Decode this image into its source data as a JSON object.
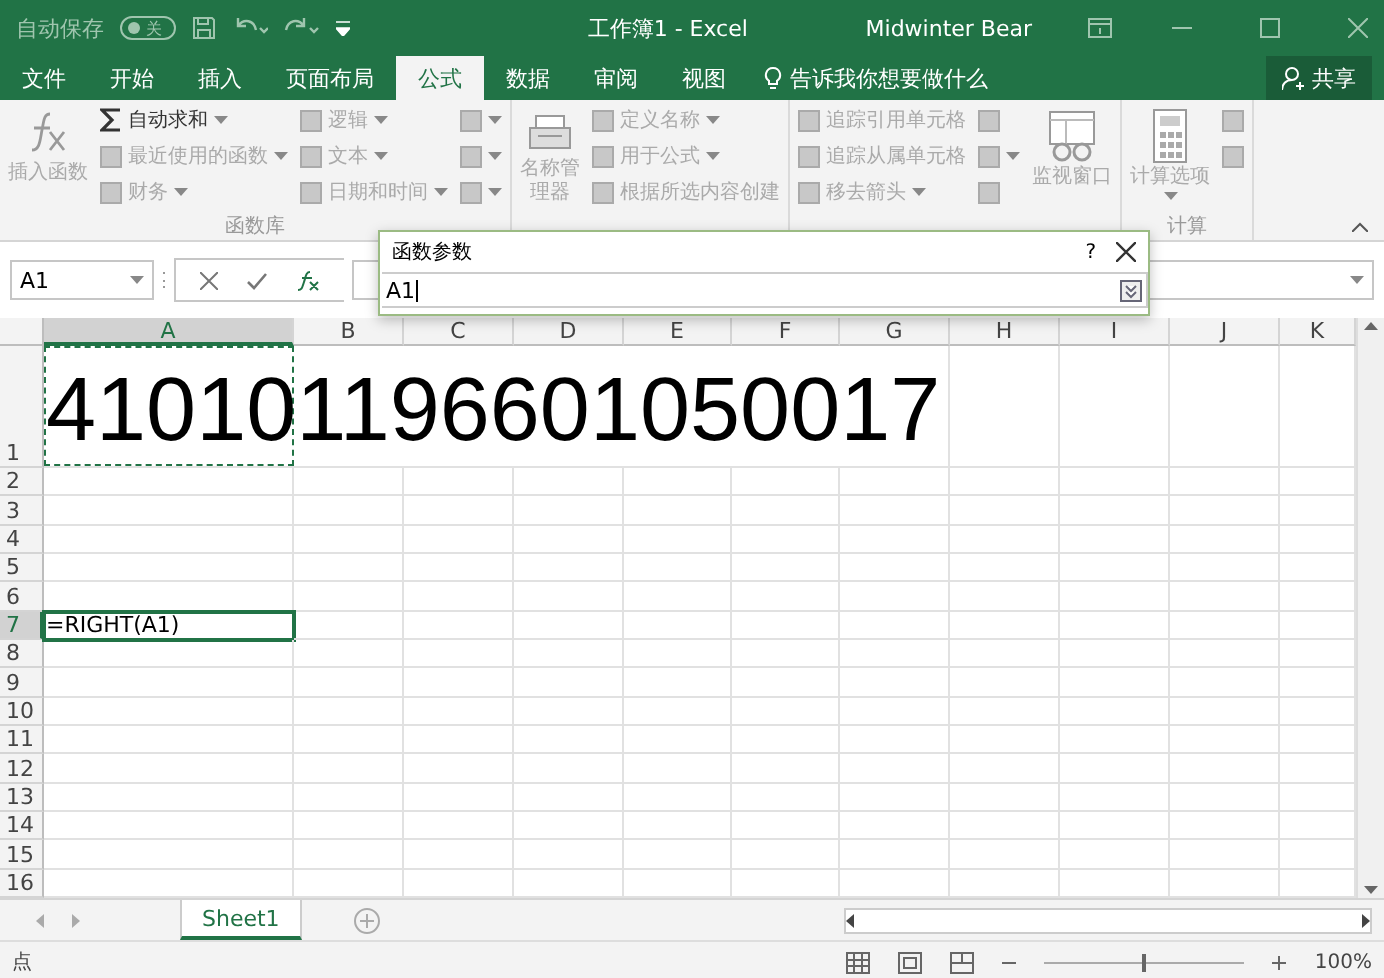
{
  "title_bar": {
    "autosave_label": "自动保存",
    "autosave": {
      "on": false,
      "label": "关"
    },
    "title": "工作簿1  -  Excel",
    "user": "Midwinter Bear"
  },
  "tabs": [
    {
      "label": "文件",
      "selected": false
    },
    {
      "label": "开始",
      "selected": false
    },
    {
      "label": "插入",
      "selected": false
    },
    {
      "label": "页面布局",
      "selected": false
    },
    {
      "label": "公式",
      "selected": true
    },
    {
      "label": "数据",
      "selected": false
    },
    {
      "label": "审阅",
      "selected": false
    },
    {
      "label": "视图",
      "selected": false
    }
  ],
  "tell_me": "告诉我你想要做什么",
  "share": "共享",
  "ribbon": {
    "groups": [
      {
        "label": "函数库",
        "columns": [
          [
            {
              "kind": "large",
              "label": "插入函数",
              "dropdown": false,
              "disabled": true
            }
          ],
          [
            {
              "kind": "small",
              "label": "自动求和",
              "dropdown": true,
              "disabled": false
            },
            {
              "kind": "small",
              "label": "最近使用的函数",
              "dropdown": true,
              "disabled": true
            },
            {
              "kind": "small",
              "label": "财务",
              "dropdown": true,
              "disabled": true
            }
          ],
          [
            {
              "kind": "small",
              "label": "逻辑",
              "dropdown": true,
              "disabled": true
            },
            {
              "kind": "small",
              "label": "文本",
              "dropdown": true,
              "disabled": true
            },
            {
              "kind": "small",
              "label": "日期和时间",
              "dropdown": true,
              "disabled": true
            }
          ],
          [
            {
              "kind": "icon",
              "dropdown": true,
              "disabled": true
            },
            {
              "kind": "icon",
              "dropdown": true,
              "disabled": true
            },
            {
              "kind": "icon",
              "dropdown": true,
              "disabled": true
            }
          ]
        ]
      },
      {
        "columns": [
          [
            {
              "kind": "large",
              "label": "名称管理器",
              "dropdown": false,
              "disabled": true
            }
          ],
          [
            {
              "kind": "small",
              "label": "定义名称",
              "dropdown": true,
              "disabled": true
            },
            {
              "kind": "small",
              "label": "用于公式",
              "dropdown": true,
              "disabled": true
            },
            {
              "kind": "small",
              "label": "根据所选内容创建",
              "dropdown": false,
              "disabled": true
            }
          ]
        ]
      },
      {
        "columns": [
          [
            {
              "kind": "small",
              "label": "追踪引用单元格",
              "dropdown": false,
              "disabled": true
            },
            {
              "kind": "small",
              "label": "追踪从属单元格",
              "dropdown": false,
              "disabled": true
            },
            {
              "kind": "small",
              "label": "移去箭头",
              "dropdown": true,
              "disabled": true
            }
          ],
          [
            {
              "kind": "icon",
              "dropdown": false,
              "disabled": true
            },
            {
              "kind": "icon",
              "dropdown": true,
              "disabled": true
            },
            {
              "kind": "icon",
              "dropdown": false,
              "disabled": true
            }
          ],
          [
            {
              "kind": "large",
              "label": "监视窗口",
              "dropdown": false,
              "disabled": true
            }
          ]
        ]
      },
      {
        "label": "计算",
        "columns": [
          [
            {
              "kind": "large",
              "label": "计算选项",
              "dropdown": true,
              "disabled": true
            }
          ],
          [
            {
              "kind": "icon",
              "dropdown": false,
              "disabled": true
            },
            {
              "kind": "icon",
              "dropdown": false,
              "disabled": true
            }
          ]
        ]
      }
    ]
  },
  "name_box": "A1",
  "dialog": {
    "title": "函数参数",
    "help": "?",
    "value": "A1"
  },
  "sheet": {
    "columns": [
      "A",
      "B",
      "C",
      "D",
      "E",
      "F",
      "G",
      "H",
      "I",
      "J",
      "K"
    ],
    "rows": [
      {
        "label": "1",
        "cells": {
          "A": {
            "value": "410101196601050017",
            "kind": "big",
            "marquee": true,
            "active": false
          }
        }
      },
      {
        "label": "2"
      },
      {
        "label": "3"
      },
      {
        "label": "4"
      },
      {
        "label": "5"
      },
      {
        "label": "6"
      },
      {
        "label": "7",
        "cells": {
          "A": {
            "value": "=RIGHT(A1)",
            "kind": "normal",
            "marquee": false,
            "active": true
          }
        }
      },
      {
        "label": "8"
      },
      {
        "label": "9"
      },
      {
        "label": "10"
      },
      {
        "label": "11"
      },
      {
        "label": "12"
      },
      {
        "label": "13"
      },
      {
        "label": "14"
      },
      {
        "label": "15"
      },
      {
        "label": "16"
      }
    ]
  },
  "sheet_tabs": [
    {
      "label": "Sheet1",
      "selected": true
    }
  ],
  "status_bar": {
    "mode": "点",
    "zoom": {
      "level": 0.5,
      "label": "100%"
    }
  }
}
